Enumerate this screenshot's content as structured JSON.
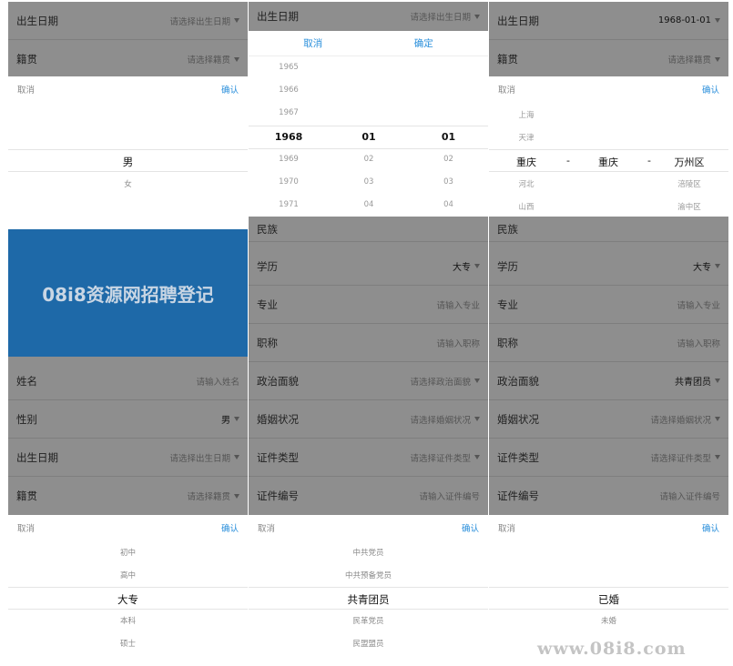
{
  "labels": {
    "birth": "出生日期",
    "native": "籍贯",
    "name": "姓名",
    "gender": "性别",
    "education": "学历",
    "major": "专业",
    "title": "职称",
    "politics": "政治面貌",
    "marital": "婚姻状况",
    "idtype": "证件类型",
    "idno": "证件编号",
    "nation": "民族"
  },
  "placeholders": {
    "birth": "请选择出生日期",
    "native": "请选择籍贯",
    "name": "请输入姓名",
    "major": "请输入专业",
    "title": "请输入职称",
    "politics": "请选择政治面貌",
    "marital": "请选择婚姻状况",
    "idtype": "请选择证件类型",
    "idno": "请输入证件编号"
  },
  "values": {
    "birth": "1968-01-01",
    "gender": "男",
    "education": "大专",
    "politics": "共青团员"
  },
  "actions": {
    "cancel": "取消",
    "confirm": "确认",
    "confirm2": "确定"
  },
  "gender_picker": {
    "selected": "男",
    "options": [
      "女"
    ]
  },
  "date_picker": {
    "years_before": [
      "1965",
      "1966",
      "1967"
    ],
    "year": "1968",
    "month": "01",
    "day": "01",
    "years_after": [
      "1969",
      "1970",
      "1971"
    ],
    "months_after": [
      "02",
      "03",
      "04"
    ],
    "days_after": [
      "02",
      "03",
      "04"
    ]
  },
  "region_picker": {
    "before": [
      "上海",
      "天津"
    ],
    "province": "重庆",
    "city": "重庆",
    "district": "万州区",
    "after_left": [
      "河北",
      "山西"
    ],
    "after_right": [
      "涪陵区",
      "渝中区"
    ],
    "sep": "-"
  },
  "banner": "08i8资源网招聘登记",
  "education_picker": {
    "before": [
      "初中",
      "高中"
    ],
    "selected": "大专",
    "after": [
      "本科",
      "硕士"
    ]
  },
  "politics_picker": {
    "before": [
      "中共党员",
      "中共预备党员"
    ],
    "selected": "共青团员",
    "after": [
      "民革党员",
      "民盟盟员"
    ]
  },
  "marital_picker": {
    "selected": "已婚",
    "after": [
      "未婚"
    ]
  },
  "watermark": "www.08i8.com"
}
